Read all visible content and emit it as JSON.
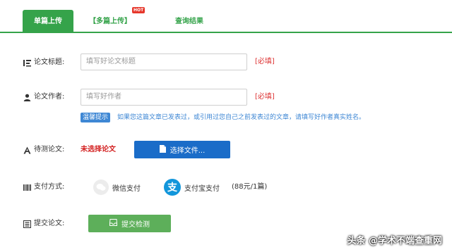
{
  "tabs": {
    "single": "单篇上传",
    "multi": "【多篇上传】",
    "hot_badge": "HOT",
    "result": "查询结果"
  },
  "form": {
    "title_label": "论文标题:",
    "title_placeholder": "填写好论文标题",
    "author_label": "论文作者:",
    "author_placeholder": "填写好作者",
    "required": "[必填]",
    "tip_badge": "温馨提示",
    "tip_text": "如果您这篇文章已发表过，或引用过您自己之前发表过的文章，请填写好作者真实姓名。",
    "paper_label": "待测论文:",
    "no_file": "未选择论文",
    "choose_file": "选择文件...",
    "pay_label": "支付方式:",
    "wechat": "微信支付",
    "alipay": "支付宝支付",
    "alipay_glyph": "支",
    "price": "(88元/1篇)",
    "submit_label": "提交论文:",
    "submit_button": "提交检测"
  },
  "watermark": "头条 @学术不端查重网",
  "colors": {
    "accent_green": "#35a34a",
    "button_blue": "#1a6cc8",
    "required_red": "#d33333",
    "tip_blue": "#3e87d4"
  }
}
